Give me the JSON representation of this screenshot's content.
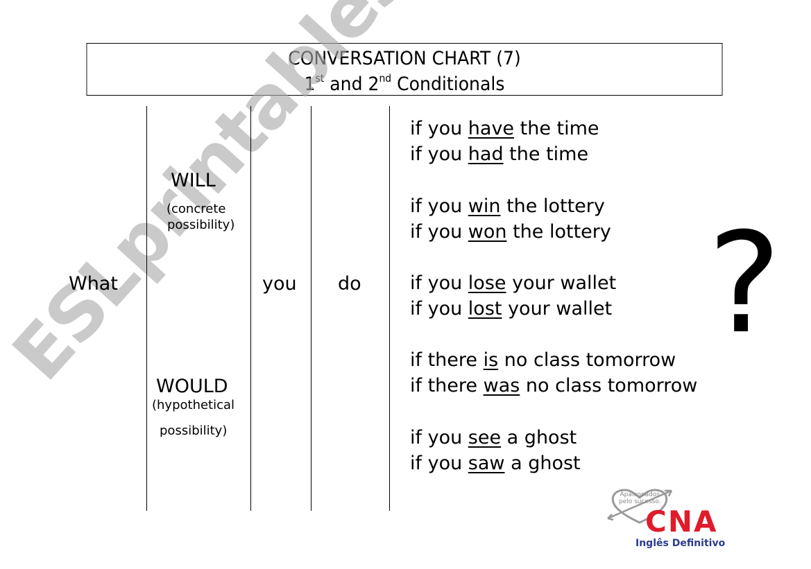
{
  "title": {
    "line1": "CONVERSATION CHART (7)",
    "line2_parts": [
      "1",
      "st",
      " and 2",
      "nd",
      " Conditionals"
    ]
  },
  "columns": {
    "what": "What",
    "will": "WILL",
    "will_note": [
      "(concrete",
      "possibility)"
    ],
    "would": "WOULD",
    "would_note": [
      "(hypothetical",
      "possibility)"
    ],
    "you": "you",
    "do": "do"
  },
  "conditions": [
    {
      "pre": "if you ",
      "verb": "have",
      "post": " the time"
    },
    {
      "pre": "if you ",
      "verb": "had",
      "post": " the time"
    },
    {
      "pre": "if you ",
      "verb": "win",
      "post": " the lottery"
    },
    {
      "pre": "if you ",
      "verb": "won",
      "post": " the lottery"
    },
    {
      "pre": "if you ",
      "verb": "lose",
      "post": " your wallet"
    },
    {
      "pre": "if you ",
      "verb": "lost",
      "post": " your wallet"
    },
    {
      "pre": "if there ",
      "verb": "is",
      "post": " no class tomorrow"
    },
    {
      "pre": "if there ",
      "verb": "was",
      "post": " no class tomorrow"
    },
    {
      "pre": "if you ",
      "verb": "see",
      "post": " a ghost"
    },
    {
      "pre": "if you ",
      "verb": "saw",
      "post": " a ghost"
    }
  ],
  "question_mark": "?",
  "watermark": "ESLprintables.com",
  "logo": {
    "tagline": [
      "Apaixonados",
      "pelo sucesso."
    ],
    "brand": "CNA",
    "subtitle": "Inglês Definitivo",
    "brand_color": "#e01b2a",
    "subtitle_color": "#2a3b8f"
  }
}
